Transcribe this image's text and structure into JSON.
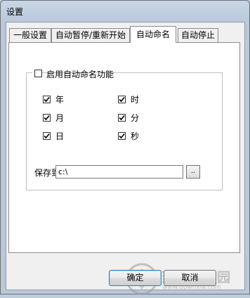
{
  "window": {
    "title": "设置"
  },
  "tabs": [
    {
      "label": "一般设置",
      "active": false
    },
    {
      "label": "自动暂停/重新开始",
      "active": false
    },
    {
      "label": "自动命名",
      "active": true
    },
    {
      "label": "自动停止",
      "active": false
    }
  ],
  "auto_name": {
    "enable_label": "启用自动命名功能",
    "enable_checked": false,
    "options": {
      "year": {
        "label": "年",
        "checked": true
      },
      "month": {
        "label": "月",
        "checked": true
      },
      "day": {
        "label": "日",
        "checked": true
      },
      "hour": {
        "label": "时",
        "checked": true
      },
      "minute": {
        "label": "分",
        "checked": true
      },
      "second": {
        "label": "秒",
        "checked": true
      }
    },
    "save_to_label": "保存到",
    "save_path_value": "c:\\",
    "browse_label": ".."
  },
  "buttons": {
    "ok_label": "确定",
    "cancel_label": "取消"
  },
  "watermark": {
    "text": "当下软件园",
    "url": "www.downxia.com"
  },
  "colors": {
    "frame": "#bfcddb",
    "panel": "#ffffff",
    "client": "#f0f0f0",
    "default_button_border": "#3c7fb1"
  }
}
